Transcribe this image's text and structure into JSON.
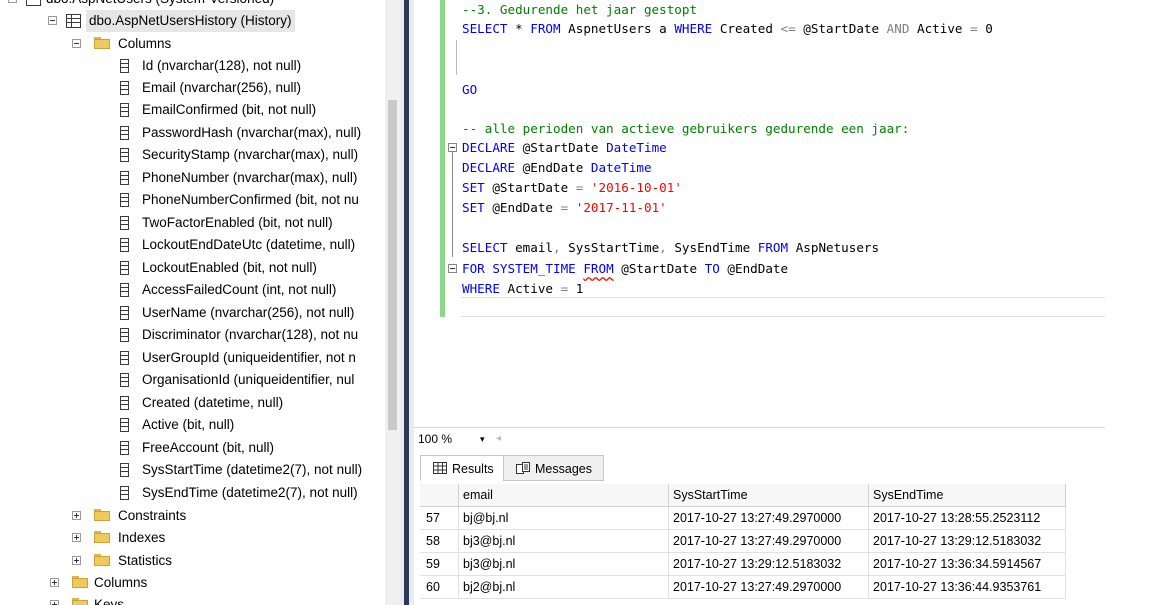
{
  "explorer": {
    "top_partial_label": "dbo.AspNetUsers (System-Versioned)",
    "history_table": "dbo.AspNetUsersHistory (History)",
    "columns_folder": "Columns",
    "columns": [
      "Id (nvarchar(128), not null)",
      "Email (nvarchar(256), null)",
      "EmailConfirmed (bit, not null)",
      "PasswordHash (nvarchar(max), null)",
      "SecurityStamp (nvarchar(max), null)",
      "PhoneNumber (nvarchar(max), null)",
      "PhoneNumberConfirmed (bit, not nu",
      "TwoFactorEnabled (bit, not null)",
      "LockoutEndDateUtc (datetime, null)",
      "LockoutEnabled (bit, not null)",
      "AccessFailedCount (int, not null)",
      "UserName (nvarchar(256), not null)",
      "Discriminator (nvarchar(128), not nu",
      "UserGroupId (uniqueidentifier, not n",
      "OrganisationId (uniqueidentifier, nul",
      "Created (datetime, null)",
      "Active (bit, null)",
      "FreeAccount (bit, null)",
      "SysStartTime (datetime2(7), not null)",
      "SysEndTime (datetime2(7), not null)"
    ],
    "sub_folders": [
      "Constraints",
      "Indexes",
      "Statistics"
    ],
    "outer_folders": [
      "Columns",
      "Keys"
    ]
  },
  "editor": {
    "line1": "--3. Gedurende het jaar gestopt",
    "line2": {
      "select": "SELECT",
      "star": " * ",
      "from": "FROM",
      "t1": " AspnetUsers a ",
      "where": "WHERE",
      "t2": " Created ",
      "op": "<=",
      "t3": " @StartDate ",
      "and": "AND",
      "t4": " Active ",
      "eq": "=",
      "t5": " 0"
    },
    "go": "GO",
    "comment2": "-- alle perioden van actieve gebruikers gedurende een jaar:",
    "declare1": {
      "kw": "DECLARE",
      "var": " @StartDate ",
      "type": "DateTime"
    },
    "declare2": {
      "kw": "DECLARE",
      "var": " @EndDate ",
      "type": "DateTime"
    },
    "set1": {
      "kw": "SET",
      "var": " @StartDate ",
      "eq": "=",
      "val": " '2016-10-01'"
    },
    "set2": {
      "kw": "SET",
      "var": " @EndDate ",
      "eq": "=",
      "val": " '2017-11-01'"
    },
    "select2": {
      "kw": "SELECT",
      "cols1": " email",
      "c1": ",",
      "cols2": " SysStartTime",
      "c2": ",",
      "cols3": " SysEndTime ",
      "from": "FROM",
      "tbl": " AspNetusers"
    },
    "for_line": {
      "kw1": "FOR",
      "kw2": " SYSTEM_TIME ",
      "from": "FROM",
      "rest1": " @StartDate ",
      "to": "TO",
      "rest2": " @EndDate"
    },
    "where_line": {
      "kw": "WHERE",
      "rest": " Active ",
      "eq": "=",
      "val": " 1"
    }
  },
  "zoom": {
    "value": "100 %",
    "arrow": "▾",
    "scroll_left": "◂"
  },
  "results": {
    "tabs": [
      {
        "label": "Results",
        "active": true
      },
      {
        "label": "Messages",
        "active": false
      }
    ],
    "headers": [
      "email",
      "SysStartTime",
      "SysEndTime"
    ],
    "rows": [
      {
        "num": "57",
        "email": "bj@bj.nl",
        "start": "2017-10-27 13:27:49.2970000",
        "end": "2017-10-27 13:28:55.2523112"
      },
      {
        "num": "58",
        "email": "bj3@bj.nl",
        "start": "2017-10-27 13:27:49.2970000",
        "end": "2017-10-27 13:29:12.5183032"
      },
      {
        "num": "59",
        "email": "bj3@bj.nl",
        "start": "2017-10-27 13:29:12.5183032",
        "end": "2017-10-27 13:36:34.5914567"
      },
      {
        "num": "60",
        "email": "bj2@bj.nl",
        "start": "2017-10-27 13:27:49.2970000",
        "end": "2017-10-27 13:36:44.9353761"
      }
    ]
  },
  "colors": {
    "comment": "#008000",
    "keyword": "#0000ff",
    "string": "#ff0000",
    "operator": "#808080",
    "splitter": "#2b3a56",
    "changebar": "#8fd88a"
  }
}
